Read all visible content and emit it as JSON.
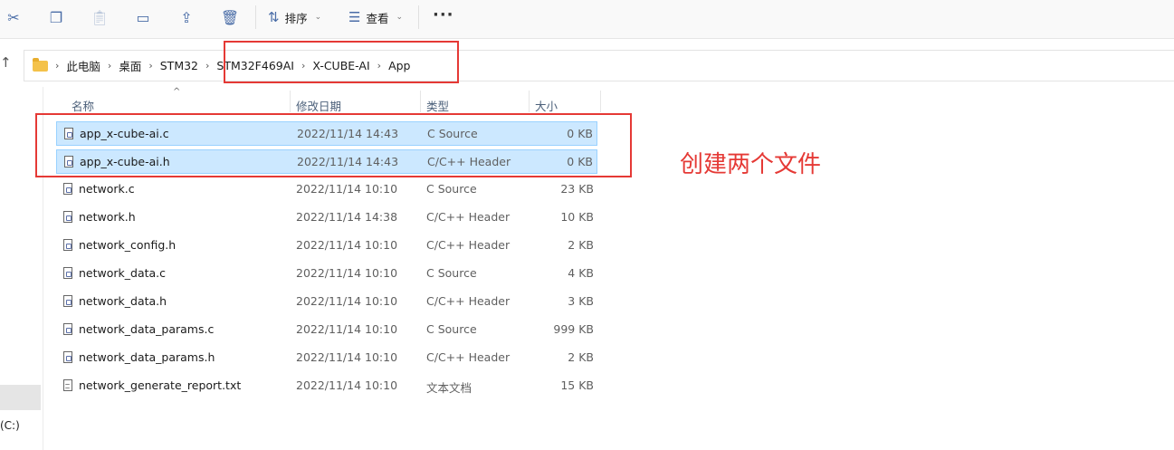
{
  "toolbar": {
    "sort_label": "排序",
    "view_label": "查看",
    "more_label": "···"
  },
  "breadcrumb": [
    "此电脑",
    "桌面",
    "STM32",
    "STM32F469AI",
    "X-CUBE-AI",
    "App"
  ],
  "columns": {
    "name": "名称",
    "date": "修改日期",
    "type": "类型",
    "size": "大小"
  },
  "files": [
    {
      "name": "app_x-cube-ai.c",
      "date": "2022/11/14 14:43",
      "type": "C Source",
      "size": "0 KB",
      "selected": true,
      "icon": "c-source-file-icon"
    },
    {
      "name": "app_x-cube-ai.h",
      "date": "2022/11/14 14:43",
      "type": "C/C++ Header",
      "size": "0 KB",
      "selected": true,
      "icon": "c-header-file-icon"
    },
    {
      "name": "network.c",
      "date": "2022/11/14 10:10",
      "type": "C Source",
      "size": "23 KB",
      "icon": "c-source-file-icon"
    },
    {
      "name": "network.h",
      "date": "2022/11/14 14:38",
      "type": "C/C++ Header",
      "size": "10 KB",
      "icon": "c-header-file-icon"
    },
    {
      "name": "network_config.h",
      "date": "2022/11/14 10:10",
      "type": "C/C++ Header",
      "size": "2 KB",
      "icon": "c-header-file-icon"
    },
    {
      "name": "network_data.c",
      "date": "2022/11/14 10:10",
      "type": "C Source",
      "size": "4 KB",
      "icon": "c-source-file-icon"
    },
    {
      "name": "network_data.h",
      "date": "2022/11/14 10:10",
      "type": "C/C++ Header",
      "size": "3 KB",
      "icon": "c-header-file-icon"
    },
    {
      "name": "network_data_params.c",
      "date": "2022/11/14 10:10",
      "type": "C Source",
      "size": "999 KB",
      "icon": "c-source-file-icon"
    },
    {
      "name": "network_data_params.h",
      "date": "2022/11/14 10:10",
      "type": "C/C++ Header",
      "size": "2 KB",
      "icon": "c-header-file-icon"
    },
    {
      "name": "network_generate_report.txt",
      "date": "2022/11/14 10:10",
      "type": "文本文档",
      "size": "15 KB",
      "icon": "text-file-icon"
    }
  ],
  "sidebar": {
    "drive_label": "(C:)"
  },
  "annotation": {
    "text": "创建两个文件",
    "color": "#e53935"
  }
}
